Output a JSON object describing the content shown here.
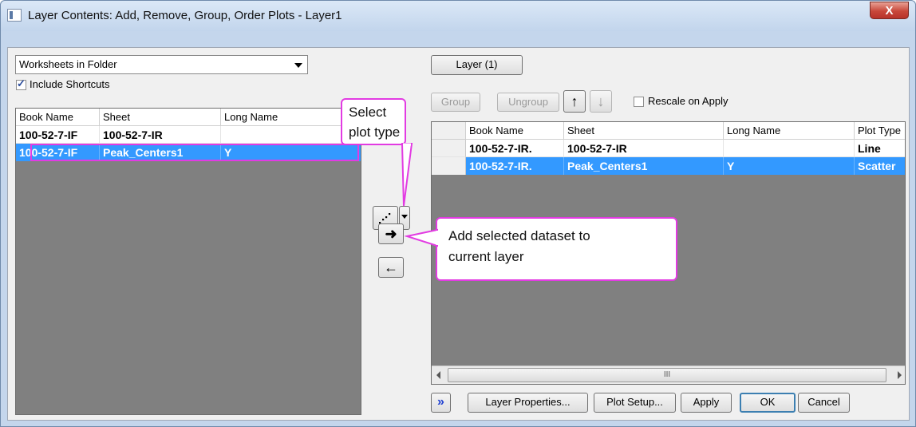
{
  "window": {
    "title": "Layer Contents: Add, Remove, Group, Order Plots - Layer1",
    "close_label": "X"
  },
  "left_panel": {
    "source_dropdown": "Worksheets in Folder",
    "include_shortcuts_label": "Include Shortcuts",
    "include_shortcuts_checked": true,
    "columns": [
      "Book Name",
      "Sheet",
      "Long Name"
    ],
    "rows": [
      {
        "book": "100-52-7-IF",
        "sheet": "100-52-7-IR",
        "long_name": "",
        "selected": false
      },
      {
        "book": "100-52-7-IF",
        "sheet": "Peak_Centers1",
        "long_name": "Y",
        "selected": true
      }
    ]
  },
  "middle": {
    "plot_type_icon": "scatter-plot-icon",
    "add_icon": "arrow-right-icon",
    "remove_icon": "arrow-left-icon",
    "callout_select_plot_type": [
      "Select",
      "plot type"
    ],
    "callout_add_dataset": [
      "Add selected dataset to",
      "current layer"
    ]
  },
  "right_panel": {
    "layer_button": "Layer (1)",
    "group_button": "Group",
    "ungroup_button": "Ungroup",
    "rescale_label": "Rescale on Apply",
    "rescale_checked": false,
    "columns": [
      "Book Name",
      "Sheet",
      "Long Name",
      "Plot Type"
    ],
    "rows": [
      {
        "book": "100-52-7-IR.",
        "sheet": "100-52-7-IR",
        "long_name": "",
        "plot_type": "Line",
        "selected": false
      },
      {
        "book": "100-52-7-IR.",
        "sheet": "Peak_Centers1",
        "long_name": "Y",
        "plot_type": "Scatter",
        "selected": true
      }
    ],
    "scroll_thumb_label": "III"
  },
  "bottom": {
    "expand_label": "»",
    "layer_properties": "Layer Properties...",
    "plot_setup": "Plot Setup...",
    "apply": "Apply",
    "ok": "OK",
    "cancel": "Cancel"
  },
  "colors": {
    "selection": "#3399ff",
    "callout_border": "#e23be2",
    "grid_bg": "#808080"
  }
}
